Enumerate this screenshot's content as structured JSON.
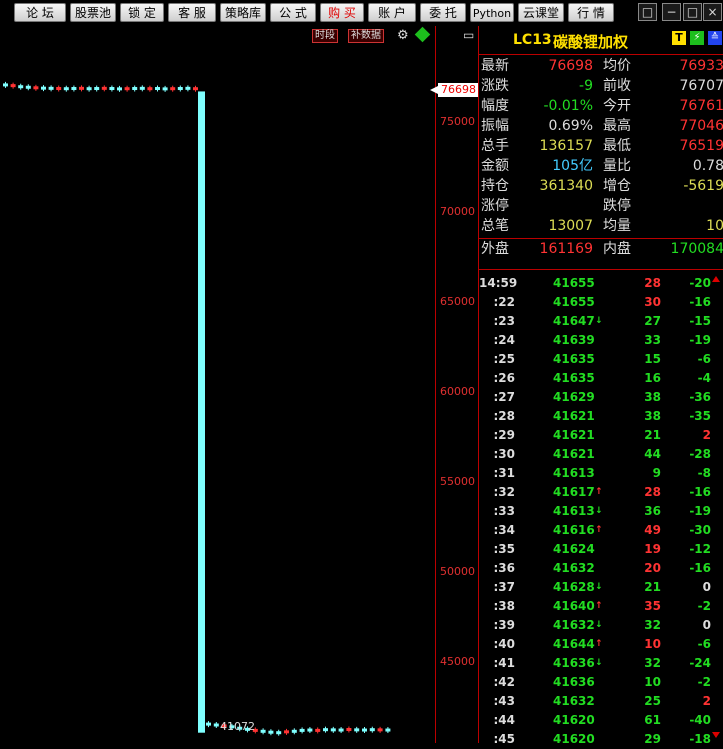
{
  "toolbar": {
    "buttons": [
      "论 坛",
      "股票池",
      "锁 定",
      "客 服",
      "策略库",
      "公 式",
      "购 买",
      "账 户",
      "委 托",
      "Python",
      "云课堂",
      "行 情"
    ],
    "window_controls": [
      "□",
      "−",
      "□",
      "×"
    ]
  },
  "chart": {
    "buttons": [
      "时段",
      "补数据"
    ],
    "current_price_label": "76698",
    "low_price_label": "41072",
    "y_ticks": [
      "75000",
      "70000",
      "65000",
      "60000",
      "55000",
      "50000",
      "45000"
    ],
    "bar": {
      "top_value": 76698,
      "bottom_value": 41072
    }
  },
  "header": {
    "code": "LC13",
    "name": "碳酸锂加权",
    "badges": [
      "T",
      "⚡",
      "≙"
    ]
  },
  "quote": [
    {
      "l1": "最新",
      "v1": "76698",
      "c1": "#ff3333",
      "l2": "均价",
      "v2": "76933",
      "c2": "#ff3333"
    },
    {
      "l1": "涨跌",
      "v1": "-9",
      "c1": "#22dd22",
      "l2": "前收",
      "v2": "76707",
      "c2": "#dddddd"
    },
    {
      "l1": "幅度",
      "v1": "-0.01%",
      "c1": "#22dd22",
      "l2": "今开",
      "v2": "76761",
      "c2": "#ff3333"
    },
    {
      "l1": "振幅",
      "v1": "0.69%",
      "c1": "#dddddd",
      "l2": "最高",
      "v2": "77046",
      "c2": "#ff3333"
    },
    {
      "l1": "总手",
      "v1": "136157",
      "c1": "#dddd55",
      "l2": "最低",
      "v2": "76519",
      "c2": "#ff3333"
    },
    {
      "l1": "金额",
      "v1": "105亿",
      "c1": "#44ccff",
      "l2": "量比",
      "v2": "0.78",
      "c2": "#dddddd"
    },
    {
      "l1": "持仓",
      "v1": "361340",
      "c1": "#dddd55",
      "l2": "增仓",
      "v2": "-5619",
      "c2": "#dddd55"
    },
    {
      "l1": "涨停",
      "v1": "",
      "c1": "#dddddd",
      "l2": "跌停",
      "v2": "",
      "c2": "#dddddd"
    },
    {
      "l1": "总笔",
      "v1": "13007",
      "c1": "#dddd55",
      "l2": "均量",
      "v2": "10",
      "c2": "#dddd55"
    }
  ],
  "outer_inner": {
    "outer_label": "外盘",
    "outer_value": "161169",
    "inner_label": "内盘",
    "inner_value": "170084"
  },
  "ticks": [
    {
      "time": "14:59",
      "price": "41655",
      "arrow": "",
      "vol": "28",
      "vol_color": "#ff3333",
      "chg": "-20",
      "chg_color": "#22dd22"
    },
    {
      "time": ":22",
      "price": "41655",
      "arrow": "",
      "vol": "30",
      "vol_color": "#ff3333",
      "chg": "-16",
      "chg_color": "#22dd22"
    },
    {
      "time": ":23",
      "price": "41647",
      "arrow": "↓",
      "vol": "27",
      "vol_color": "#22dd22",
      "chg": "-15",
      "chg_color": "#22dd22"
    },
    {
      "time": ":24",
      "price": "41639",
      "arrow": "",
      "vol": "33",
      "vol_color": "#22dd22",
      "chg": "-19",
      "chg_color": "#22dd22"
    },
    {
      "time": ":25",
      "price": "41635",
      "arrow": "",
      "vol": "15",
      "vol_color": "#22dd22",
      "chg": "-6",
      "chg_color": "#22dd22"
    },
    {
      "time": ":26",
      "price": "41635",
      "arrow": "",
      "vol": "16",
      "vol_color": "#22dd22",
      "chg": "-4",
      "chg_color": "#22dd22"
    },
    {
      "time": ":27",
      "price": "41629",
      "arrow": "",
      "vol": "38",
      "vol_color": "#22dd22",
      "chg": "-36",
      "chg_color": "#22dd22"
    },
    {
      "time": ":28",
      "price": "41621",
      "arrow": "",
      "vol": "38",
      "vol_color": "#22dd22",
      "chg": "-35",
      "chg_color": "#22dd22"
    },
    {
      "time": ":29",
      "price": "41621",
      "arrow": "",
      "vol": "21",
      "vol_color": "#22dd22",
      "chg": "2",
      "chg_color": "#ff3333"
    },
    {
      "time": ":30",
      "price": "41621",
      "arrow": "",
      "vol": "44",
      "vol_color": "#22dd22",
      "chg": "-28",
      "chg_color": "#22dd22"
    },
    {
      "time": ":31",
      "price": "41613",
      "arrow": "",
      "vol": "9",
      "vol_color": "#22dd22",
      "chg": "-8",
      "chg_color": "#22dd22"
    },
    {
      "time": ":32",
      "price": "41617",
      "arrow": "↑",
      "vol": "28",
      "vol_color": "#ff3333",
      "chg": "-16",
      "chg_color": "#22dd22"
    },
    {
      "time": ":33",
      "price": "41613",
      "arrow": "↓",
      "vol": "36",
      "vol_color": "#22dd22",
      "chg": "-19",
      "chg_color": "#22dd22"
    },
    {
      "time": ":34",
      "price": "41616",
      "arrow": "↑",
      "vol": "49",
      "vol_color": "#ff3333",
      "chg": "-30",
      "chg_color": "#22dd22"
    },
    {
      "time": ":35",
      "price": "41624",
      "arrow": "",
      "vol": "19",
      "vol_color": "#ff3333",
      "chg": "-12",
      "chg_color": "#22dd22"
    },
    {
      "time": ":36",
      "price": "41632",
      "arrow": "",
      "vol": "20",
      "vol_color": "#ff3333",
      "chg": "-16",
      "chg_color": "#22dd22"
    },
    {
      "time": ":37",
      "price": "41628",
      "arrow": "↓",
      "vol": "21",
      "vol_color": "#22dd22",
      "chg": "0",
      "chg_color": "#dddddd"
    },
    {
      "time": ":38",
      "price": "41640",
      "arrow": "↑",
      "vol": "35",
      "vol_color": "#ff3333",
      "chg": "-2",
      "chg_color": "#22dd22"
    },
    {
      "time": ":39",
      "price": "41632",
      "arrow": "↓",
      "vol": "32",
      "vol_color": "#22dd22",
      "chg": "0",
      "chg_color": "#dddddd"
    },
    {
      "time": ":40",
      "price": "41644",
      "arrow": "↑",
      "vol": "10",
      "vol_color": "#ff3333",
      "chg": "-6",
      "chg_color": "#22dd22"
    },
    {
      "time": ":41",
      "price": "41636",
      "arrow": "↓",
      "vol": "32",
      "vol_color": "#22dd22",
      "chg": "-24",
      "chg_color": "#22dd22"
    },
    {
      "time": ":42",
      "price": "41636",
      "arrow": "",
      "vol": "10",
      "vol_color": "#22dd22",
      "chg": "-2",
      "chg_color": "#22dd22"
    },
    {
      "time": ":43",
      "price": "41632",
      "arrow": "",
      "vol": "25",
      "vol_color": "#22dd22",
      "chg": "2",
      "chg_color": "#ff3333"
    },
    {
      "time": ":44",
      "price": "41620",
      "arrow": "",
      "vol": "61",
      "vol_color": "#22dd22",
      "chg": "-40",
      "chg_color": "#22dd22"
    },
    {
      "time": ":45",
      "price": "41620",
      "arrow": "",
      "vol": "29",
      "vol_color": "#22dd22",
      "chg": "-18",
      "chg_color": "#22dd22"
    }
  ]
}
